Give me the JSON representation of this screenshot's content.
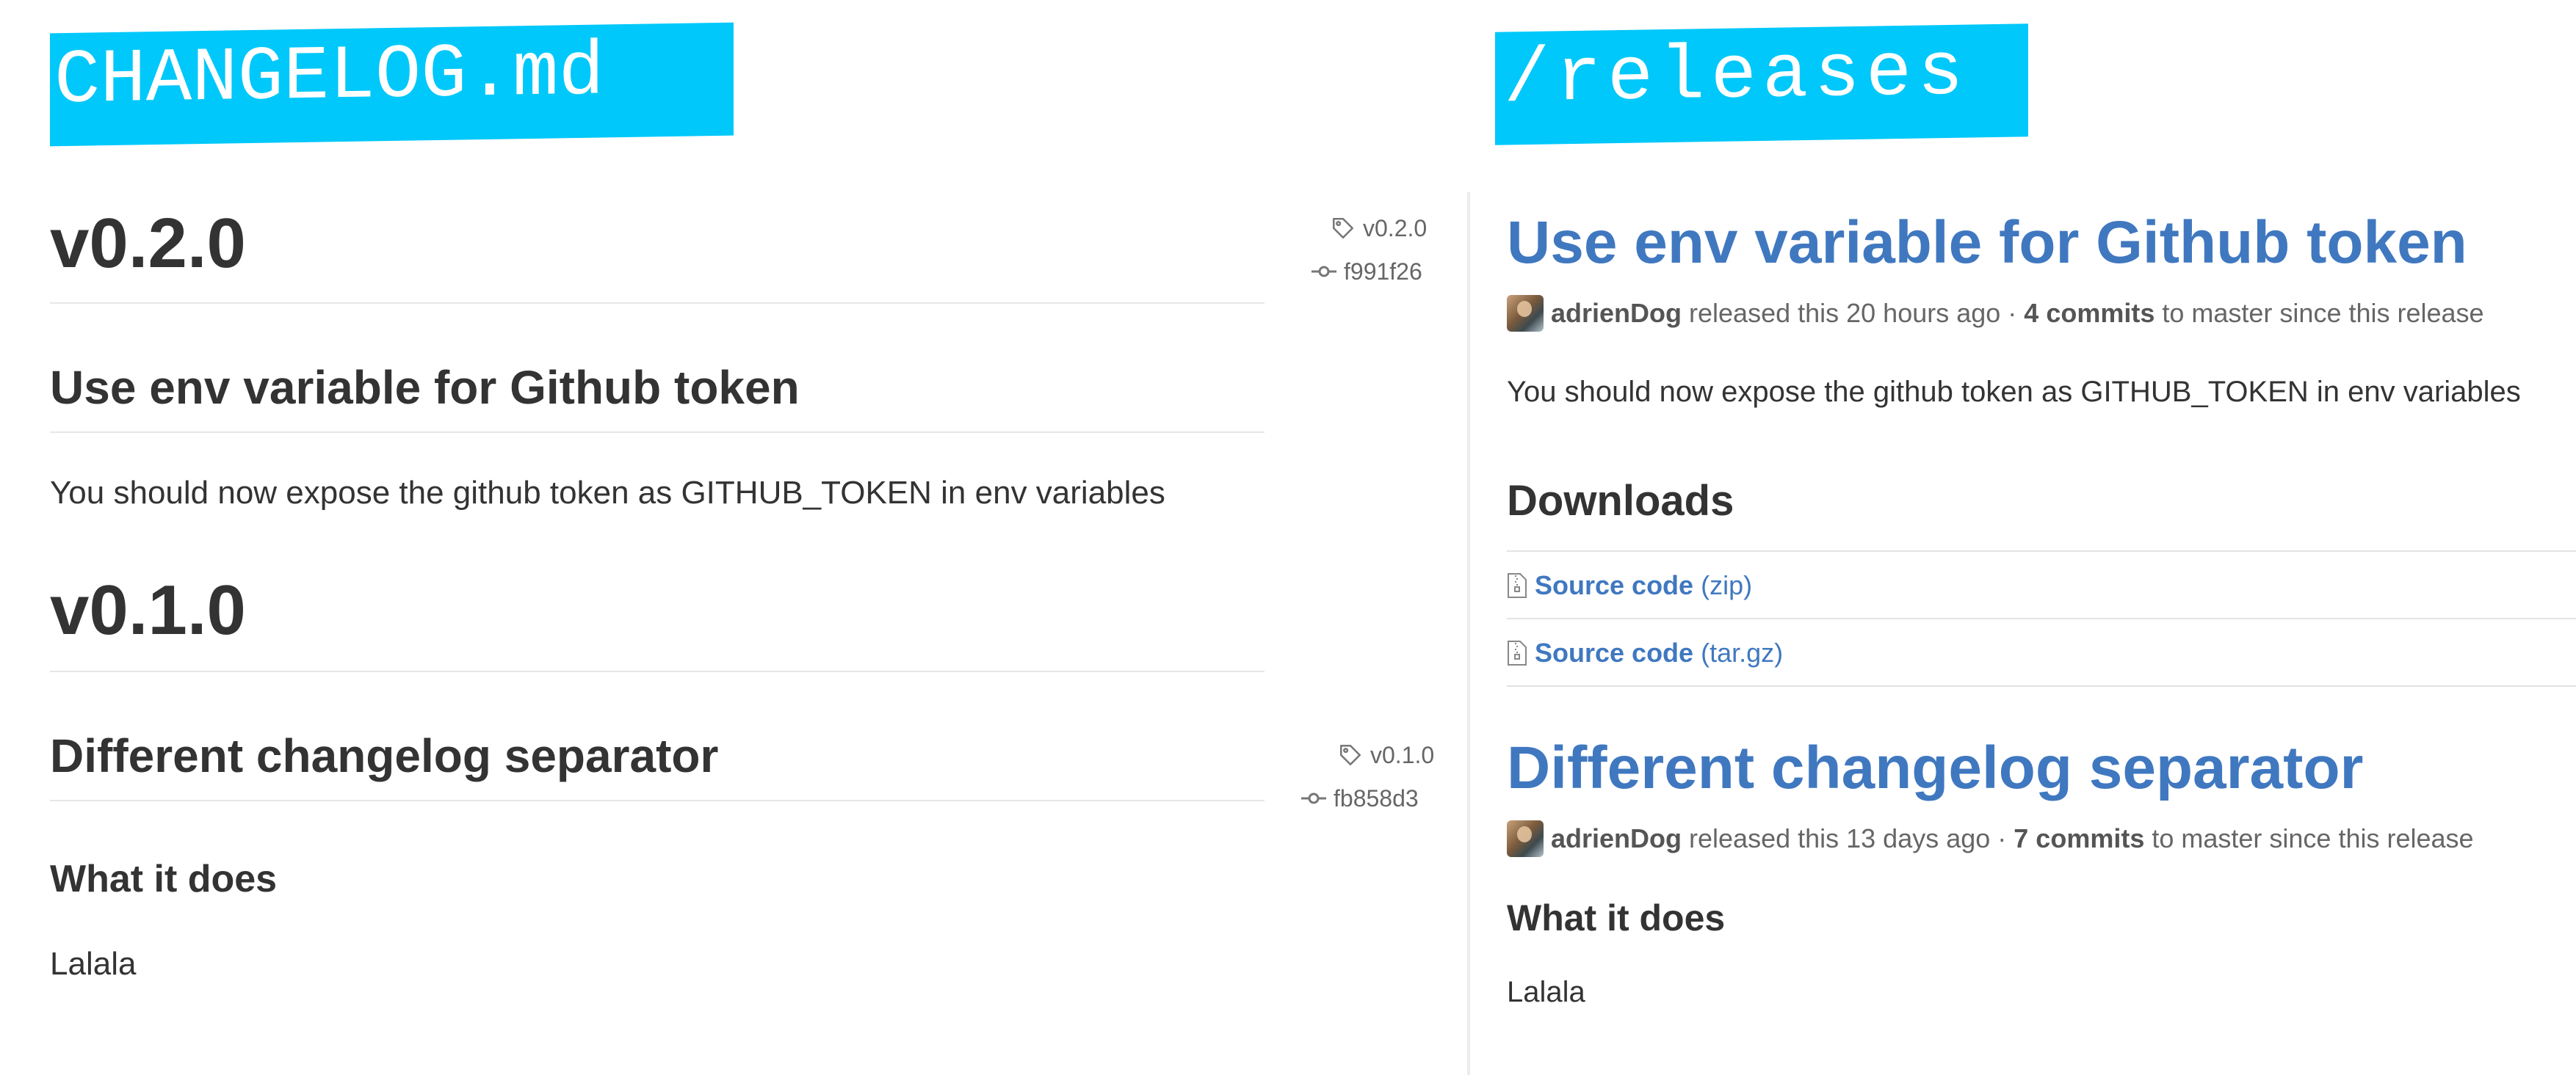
{
  "banners": {
    "left": "CHANGELOG.md",
    "right": "/releases"
  },
  "changelog": {
    "v020": {
      "heading": "v0.2.0",
      "tag": "v0.2.0",
      "commit": "f991f26",
      "entry_title": "Use env variable for Github token",
      "entry_body": "You should now expose the github token as GITHUB_TOKEN in env variables"
    },
    "v010": {
      "heading": "v0.1.0",
      "tag": "v0.1.0",
      "commit": "fb858d3",
      "entry_title": "Different changelog separator",
      "subheading": "What it does",
      "entry_body": "Lalala"
    }
  },
  "releases": {
    "r1": {
      "title": "Use env variable for Github token",
      "author": "adrienDog",
      "released_text": "released this 20 hours ago ·",
      "commits": "4 commits",
      "since_text": "to master since this release",
      "body": "You should now expose the github token as GITHUB_TOKEN in env variables",
      "downloads_heading": "Downloads",
      "downloads": [
        {
          "label": "Source code",
          "format": "(zip)"
        },
        {
          "label": "Source code",
          "format": "(tar.gz)"
        }
      ]
    },
    "r2": {
      "title": "Different changelog separator",
      "author": "adrienDog",
      "released_text": "released this 13 days ago ·",
      "commits": "7 commits",
      "since_text": "to master since this release",
      "subheading": "What it does",
      "body": "Lalala"
    }
  },
  "colors": {
    "banner": "#00c8fa",
    "link": "#4078c0",
    "text": "#333333",
    "muted": "#666666"
  },
  "icons": {
    "tag": "tag-icon",
    "commit": "git-commit-icon",
    "file_zip": "file-zip-icon"
  }
}
